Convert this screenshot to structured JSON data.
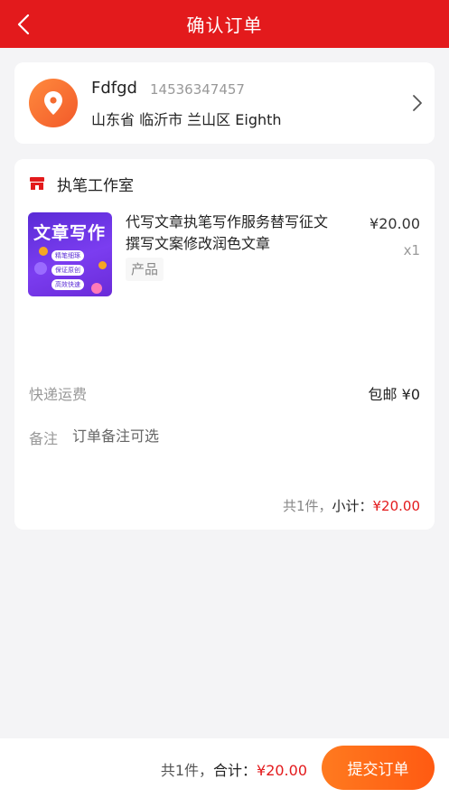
{
  "header": {
    "title": "确认订单"
  },
  "address": {
    "name": "Fdfgd",
    "phone": "14536347457",
    "detail": "山东省 临沂市 兰山区 Eighth"
  },
  "shop": {
    "name": "执笔工作室"
  },
  "product": {
    "title": "代写文章执笔写作服务替写征文撰写文案修改润色文章",
    "tag": "产品",
    "price": "¥20.00",
    "quantity": "x1",
    "image": {
      "headline": "文章写作",
      "pills": [
        "精笔细琢",
        "保证原创",
        "高效快速"
      ]
    }
  },
  "shipping": {
    "label": "快递运费",
    "value": "包邮 ¥0"
  },
  "note": {
    "label": "备注",
    "placeholder": "订单备注可选"
  },
  "subtotal": {
    "count": "共1件，",
    "label": "小计：",
    "amount": "¥20.00"
  },
  "footer": {
    "count": "共1件，",
    "label": "合计：",
    "amount": "¥20.00",
    "submit_label": "提交订单"
  },
  "colors": {
    "accent": "#e31a1c",
    "button": "#ff6a18",
    "background": "#f4f4f6"
  }
}
